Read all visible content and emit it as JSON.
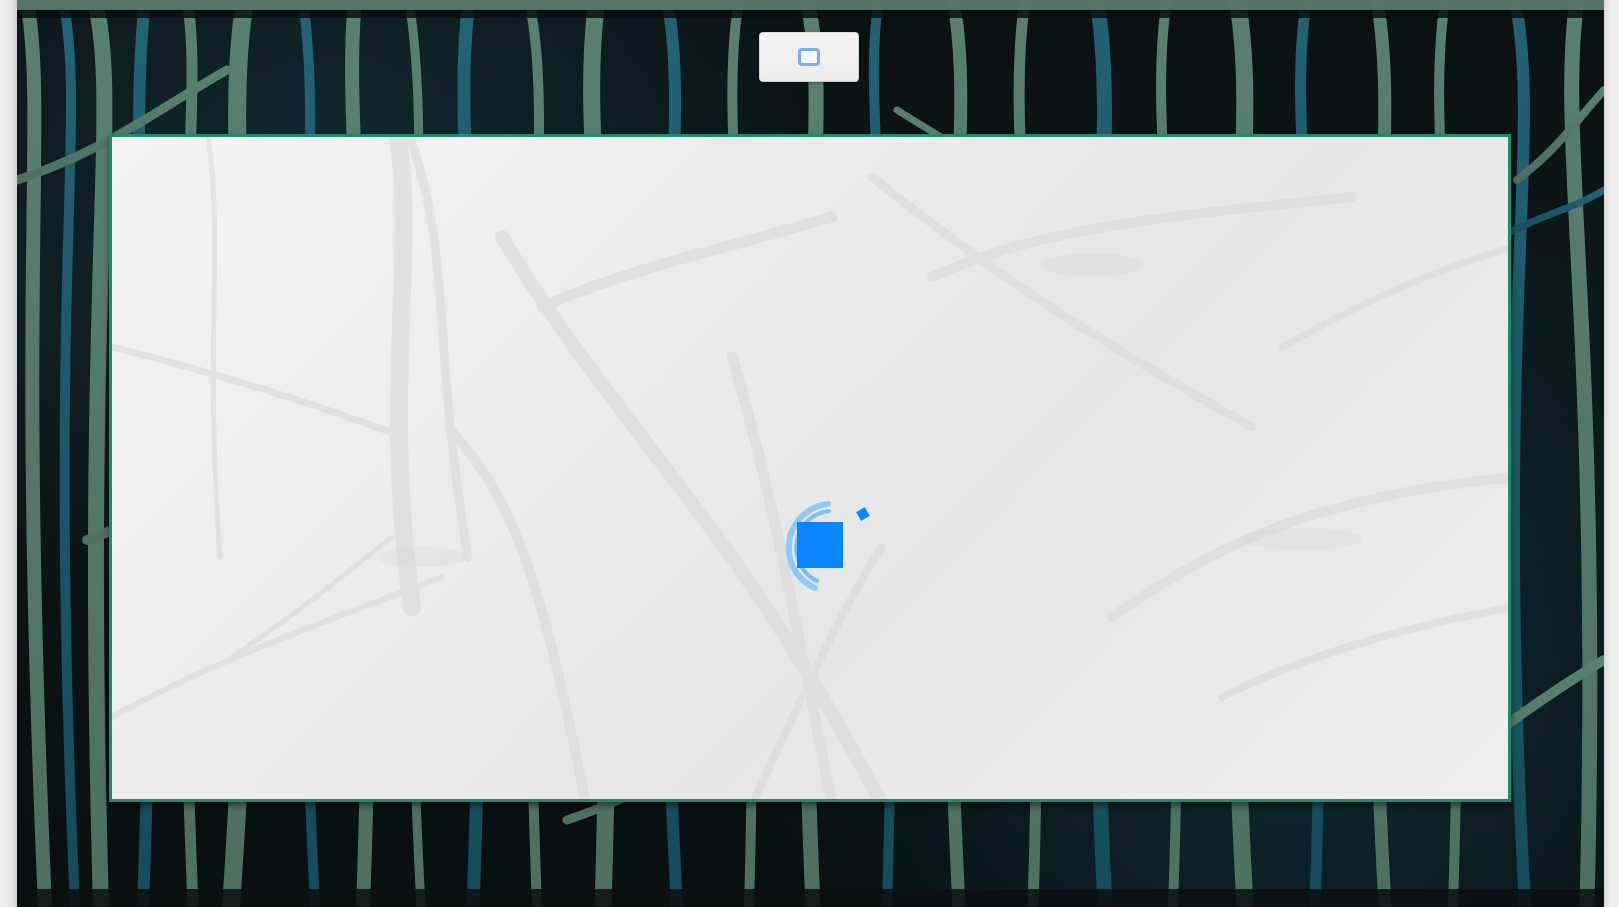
{
  "screen": {
    "background_color": "#ececec"
  },
  "toolbar": {
    "button_icon": "square-icon"
  },
  "panel": {
    "state": "loading"
  },
  "loader": {
    "icon": "loading-spinner-icon",
    "accent_color": "#0b84ff",
    "ring_color": "#66b6ff"
  },
  "frame": {
    "theme": "dark-forest-border",
    "accent_color": "#1f8a6c"
  }
}
